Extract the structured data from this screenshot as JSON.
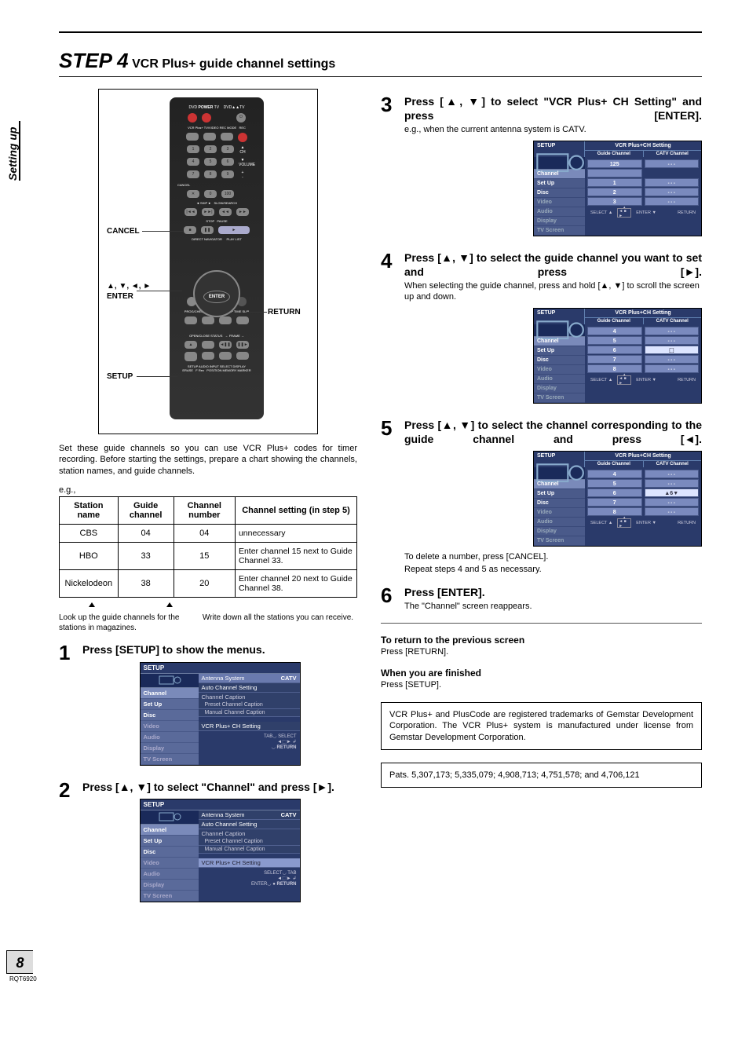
{
  "sidebar_tab": "Setting up",
  "page_number": "8",
  "page_code": "RQT6920",
  "title": {
    "step": "STEP 4",
    "rest": "VCR Plus+ guide channel settings"
  },
  "remote": {
    "cancel": "CANCEL",
    "arrows": "▲, ▼, ◄, ►",
    "enter": "ENTER",
    "return": "RETURN",
    "setup": "SETUP"
  },
  "intro": "Set these guide channels so you can use VCR Plus+ codes for timer recording. Before starting the settings, prepare a chart showing the channels, station names, and guide channels.",
  "eg": "e.g.,",
  "table": {
    "headers": [
      "Station name",
      "Guide channel",
      "Channel number",
      "Channel setting (in step 5)"
    ],
    "rows": [
      [
        "CBS",
        "04",
        "04",
        "unnecessary"
      ],
      [
        "HBO",
        "33",
        "15",
        "Enter channel 15 next to Guide Channel 33."
      ],
      [
        "Nickelodeon",
        "38",
        "20",
        "Enter channel 20 next to Guide Channel 38."
      ]
    ],
    "below_left": "Look up the guide channels for the stations in magazines.",
    "below_right": "Write down all the stations you can receive."
  },
  "setup_menu": {
    "setup_hdr": "SETUP",
    "nav": [
      "Channel",
      "Set Up",
      "Disc",
      "Video",
      "Audio",
      "Display",
      "TV Screen"
    ],
    "right_title": "VCR Plus+CH Setting",
    "cols": [
      "Guide Channel",
      "CATV Channel"
    ],
    "content1": [
      "Antenna System",
      "Auto Channel Setting",
      "Channel Caption",
      "Preset Channel Caption",
      "Manual Channel Caption",
      "VCR Plus+ CH Setting"
    ],
    "catv": "CATV",
    "hint_tab": "TAB",
    "hint_select": "SELECT",
    "hint_enter": "ENTER",
    "hint_return": "RETURN"
  },
  "steps": {
    "s1": {
      "num": "1",
      "head": "Press [SETUP] to show the menus."
    },
    "s2": {
      "num": "2",
      "head": "Press [▲, ▼] to select \"Channel\" and press [►]."
    },
    "s3": {
      "num": "3",
      "head": "Press [▲, ▼] to select \"VCR Plus+ CH Setting\" and press [ENTER].",
      "note": "e.g., when the current antenna system is CATV.",
      "grid": [
        [
          "125",
          "---"
        ],
        [
          "",
          ""
        ],
        [
          "1",
          "---"
        ],
        [
          "2",
          "---"
        ],
        [
          "3",
          "---"
        ]
      ]
    },
    "s4": {
      "num": "4",
      "head": "Press [▲, ▼] to select the guide channel you want to set and press [►].",
      "note": "When selecting the guide channel, press and hold [▲, ▼] to scroll the screen up and down.",
      "grid": [
        [
          "4",
          "---"
        ],
        [
          "5",
          "---"
        ],
        [
          "6",
          "sel"
        ],
        [
          "7",
          "---"
        ],
        [
          "8",
          "---"
        ]
      ]
    },
    "s5": {
      "num": "5",
      "head": "Press [▲, ▼] to select the channel corresponding to the guide channel and press [◄].",
      "grid": [
        [
          "4",
          "---"
        ],
        [
          "5",
          "---"
        ],
        [
          "6",
          "sel"
        ],
        [
          "7",
          "---"
        ],
        [
          "8",
          "---"
        ]
      ],
      "foot1": "To delete a number, press [CANCEL].",
      "foot2": "Repeat steps 4 and 5 as necessary."
    },
    "s6": {
      "num": "6",
      "head": "Press [ENTER].",
      "note": "The \"Channel\" screen reappears."
    }
  },
  "return_head": "To return to the previous screen",
  "return_text": "Press [RETURN].",
  "finish_head": "When you are finished",
  "finish_text": "Press [SETUP].",
  "trademark": "VCR Plus+ and PlusCode are registered trademarks of Gemstar Development Corporation. The VCR Plus+ system is manufactured under license from Gemstar Development Corporation.",
  "patents": "Pats. 5,307,173; 5,335,079; 4,908,713; 4,751,578; and 4,706,121"
}
